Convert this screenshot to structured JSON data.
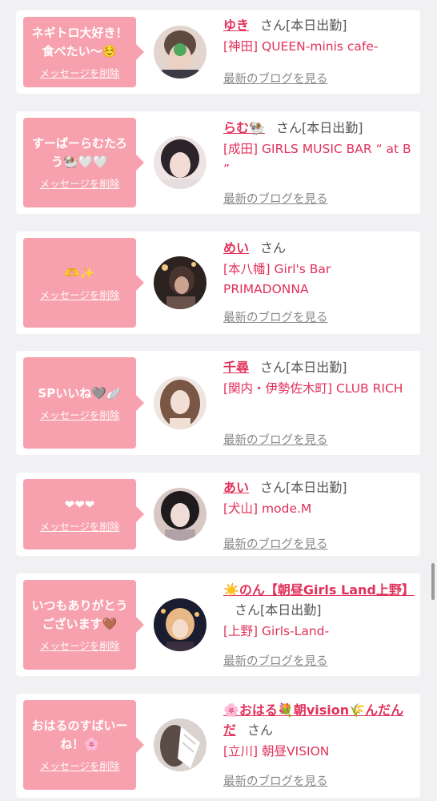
{
  "messages": [
    {
      "bubble_text": "ネギトロ大好き！食べたい〜☺️",
      "delete_label": "メッセージを削除",
      "name": "ゆき",
      "honorific": "さん",
      "status": "[本日出勤]",
      "shop": "[神田] QUEEN-minis cafe-",
      "blog_label": "最新のブログを見る",
      "avatar_colors": [
        "#6b5a52",
        "#caa99a"
      ]
    },
    {
      "bubble_text": "すーぱーらむたろう🐏🤍🤍",
      "delete_label": "メッセージを削除",
      "name": "らむ🐏",
      "honorific": "さん",
      "status": "[本日出勤]",
      "shop": "[成田] GIRLS MUSIC BAR “ at B ”",
      "blog_label": "最新のブログを見る",
      "avatar_colors": [
        "#2a2428",
        "#e9d6d4"
      ]
    },
    {
      "bubble_text": "🫶✨",
      "delete_label": "メッセージを削除",
      "name": "めい",
      "honorific": "さん",
      "status": "",
      "shop": "[本八幡] Girl's Bar PRIMADONNA",
      "blog_label": "最新のブログを見る",
      "avatar_colors": [
        "#3d2c2a",
        "#b8998c"
      ]
    },
    {
      "bubble_text": "SPいいね🩶🪽",
      "delete_label": "メッセージを削除",
      "name": "千尋",
      "honorific": "さん",
      "status": "[本日出勤]",
      "shop": "[関内・伊勢佐木町] CLUB RICH",
      "blog_label": "最新のブログを見る",
      "avatar_colors": [
        "#7b5a48",
        "#e8d7cf"
      ]
    },
    {
      "bubble_text": "❤︎❤︎❤︎",
      "delete_label": "メッセージを削除",
      "name": "あい",
      "honorific": "さん",
      "status": "[本日出勤]",
      "shop": "[犬山] mode.M",
      "blog_label": "最新のブログを見る",
      "avatar_colors": [
        "#1e1a1c",
        "#e6cfc8"
      ]
    },
    {
      "bubble_text": "いつもありがとうございます🤎",
      "delete_label": "メッセージを削除",
      "name": "☀️のん【朝昼Girls Land上野】",
      "honorific": "さん",
      "status": "[本日出勤]",
      "shop": "[上野] Girls-Land-",
      "blog_label": "最新のブログを見る",
      "avatar_colors": [
        "#1c1e34",
        "#e6b98c"
      ]
    },
    {
      "bubble_text": "おはるのすばいーね！🌸",
      "delete_label": "メッセージを削除",
      "name": "🌸おはる💐朝vision🌾んだんだ",
      "honorific": "さん",
      "status": "",
      "shop": "[立川] 朝昼VISION",
      "blog_label": "最新のブログを見る",
      "avatar_colors": [
        "#5a4c47",
        "#f2f2f2"
      ]
    }
  ]
}
